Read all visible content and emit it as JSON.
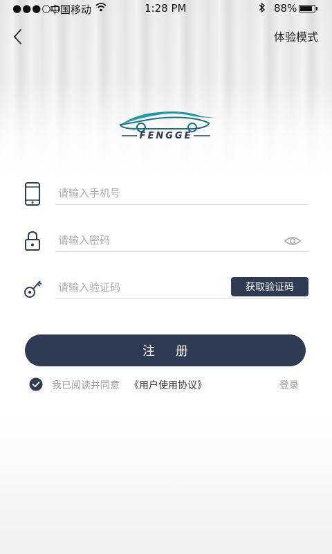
{
  "status_bar": {
    "signal": "●●●○○",
    "carrier": "中国移动",
    "time": "1:28 PM",
    "battery": "88%",
    "battery_level": 0.88
  },
  "header": {
    "trial_mode_label": "体验模式"
  },
  "logo": {
    "brand_text": "FENGGE"
  },
  "form": {
    "phone": {
      "placeholder": "请输入手机号",
      "icon": "phone-icon"
    },
    "password": {
      "placeholder": "请输入密码",
      "icon": "lock-icon",
      "toggle_icon": "eye-icon"
    },
    "code": {
      "placeholder": "请输入验证码",
      "icon": "key-icon",
      "button_label": "获取验证码"
    },
    "register_label": "注 册"
  },
  "agreement": {
    "checked": true,
    "text": "我已阅读并同意",
    "link": "《用户使用协议》",
    "login_label": "登录"
  },
  "colors": {
    "primary": "#2f3b53",
    "logo_teal": "#1f9aa6"
  }
}
